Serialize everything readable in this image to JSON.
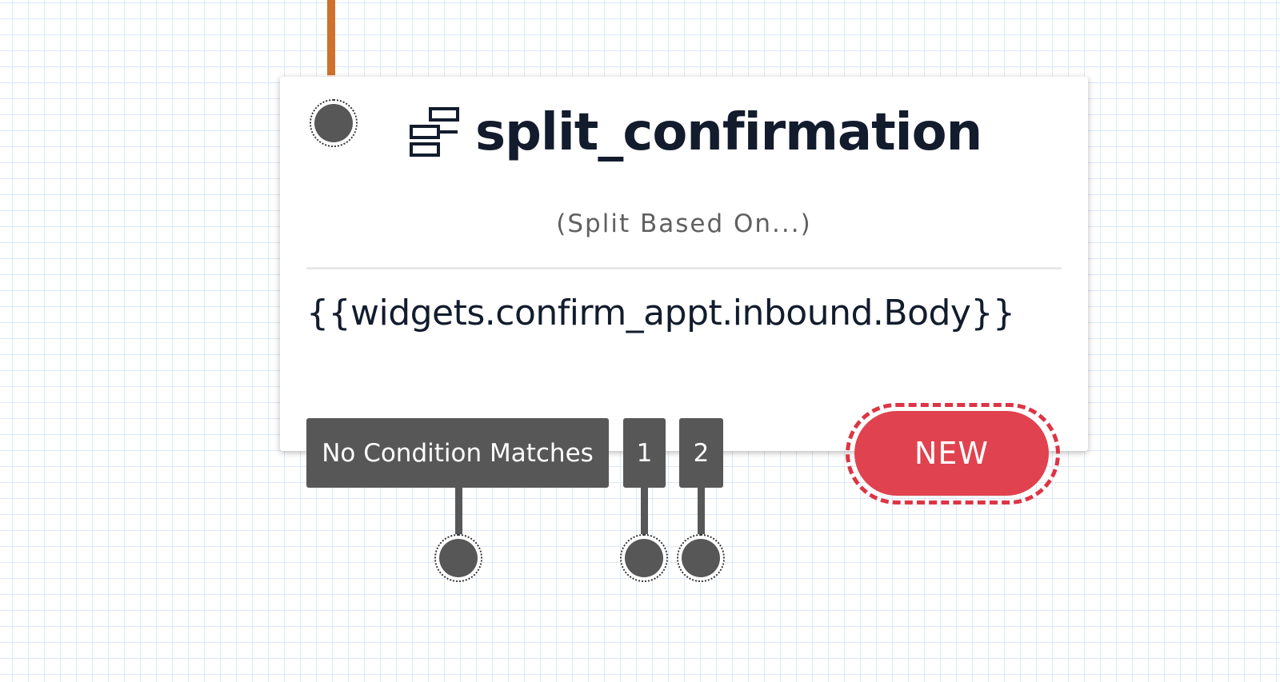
{
  "widget": {
    "title": "split_confirmation",
    "icon": "split-icon",
    "subtitle": "(Split Based On...)",
    "expression": "{{widgets.confirm_appt.inbound.Body}}"
  },
  "transitions": [
    {
      "label": "No Condition Matches"
    },
    {
      "label": "1"
    },
    {
      "label": "2"
    }
  ],
  "new_button": {
    "label": "NEW"
  },
  "colors": {
    "incoming_line": "#d0702b",
    "port": "#575757",
    "new_button": "#e0434f",
    "title_text": "#121c2d"
  }
}
